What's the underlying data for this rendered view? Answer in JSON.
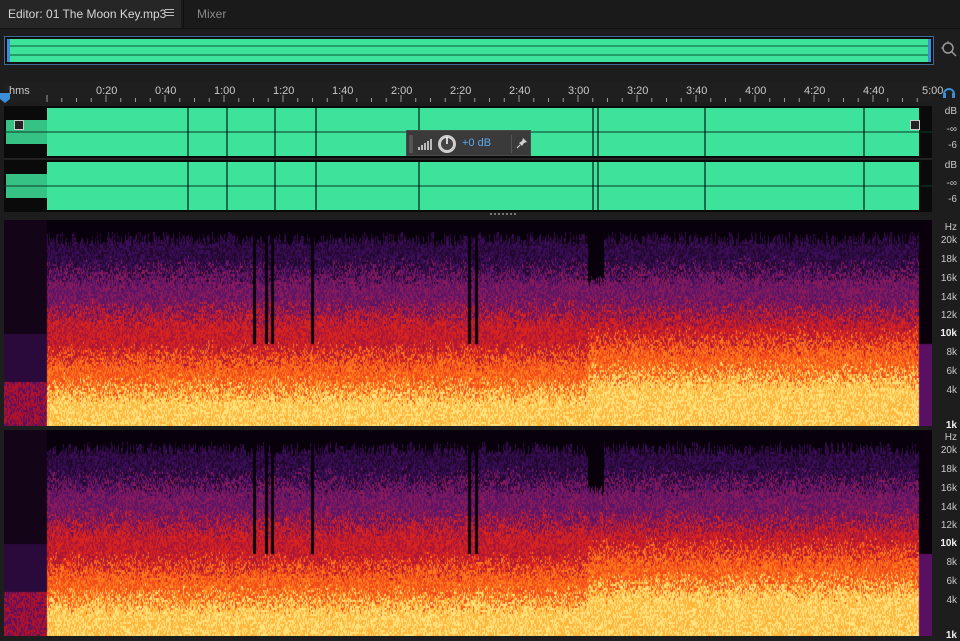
{
  "tabs": {
    "editor_label": "Editor: 01 The Moon Key.mp3",
    "mixer_label": "Mixer"
  },
  "ruler": {
    "unit": "hms",
    "ticks": [
      "0:20",
      "0:40",
      "1:00",
      "1:20",
      "1:40",
      "2:00",
      "2:20",
      "2:40",
      "3:00",
      "3:20",
      "3:40",
      "4:00",
      "4:20",
      "4:40",
      "5:00"
    ]
  },
  "hud": {
    "gain_value": "+0 dB"
  },
  "waveform": {
    "color": "#3ee39b",
    "level_scale_top": [
      {
        "text": "dB",
        "bold": false
      },
      {
        "text": "-∞",
        "bold": false
      },
      {
        "text": "-6",
        "bold": false
      }
    ],
    "level_scale_bottom": [
      {
        "text": "dB",
        "bold": false
      },
      {
        "text": "-∞",
        "bold": false
      },
      {
        "text": "-6",
        "bold": false
      }
    ]
  },
  "spectral": {
    "unit": "Hz",
    "labels": [
      {
        "text": "20k",
        "bold": false
      },
      {
        "text": "18k",
        "bold": false
      },
      {
        "text": "16k",
        "bold": false
      },
      {
        "text": "14k",
        "bold": false
      },
      {
        "text": "12k",
        "bold": false
      },
      {
        "text": "10k",
        "bold": true
      },
      {
        "text": "8k",
        "bold": false
      },
      {
        "text": "6k",
        "bold": false
      },
      {
        "text": "4k",
        "bold": false
      },
      {
        "text": "1k",
        "bold": true
      }
    ]
  },
  "colors": {
    "accent": "#3c8fd6",
    "waveform": "#3ee39b",
    "spectral_hot": "#ffe27a",
    "spectral_mid": "#e8321c",
    "spectral_cool": "#4a1466"
  }
}
